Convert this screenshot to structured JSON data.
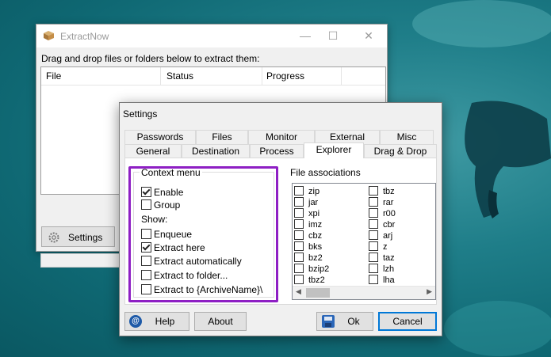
{
  "main_window": {
    "title": "ExtractNow",
    "controls": {
      "minimize": "—",
      "maximize": "☐",
      "close": "✕"
    },
    "hint": "Drag and drop files or folders below to extract them:",
    "columns": [
      "File",
      "Status",
      "Progress"
    ],
    "settings_button": "Settings"
  },
  "settings_dialog": {
    "title": "Settings",
    "tabs_row1": [
      "Passwords",
      "Files",
      "Monitor",
      "External",
      "Misc"
    ],
    "tabs_row2": [
      "General",
      "Destination",
      "Process",
      "Explorer",
      "Drag & Drop"
    ],
    "active_tab": "Explorer",
    "context_menu": {
      "caption": "Context menu",
      "enable": {
        "label": "Enable",
        "checked": true
      },
      "group": {
        "label": "Group",
        "checked": false
      },
      "show_label": "Show:",
      "options": [
        {
          "label": "Enqueue",
          "checked": false
        },
        {
          "label": "Extract here",
          "checked": true
        },
        {
          "label": "Extract automatically",
          "checked": false
        },
        {
          "label": "Extract to folder...",
          "checked": false
        },
        {
          "label": "Extract to {ArchiveName}\\",
          "checked": false
        }
      ]
    },
    "file_associations": {
      "caption": "File associations",
      "col1": [
        "zip",
        "jar",
        "xpi",
        "imz",
        "cbz",
        "bks",
        "bz2",
        "bzip2",
        "tbz2"
      ],
      "col2": [
        "tbz",
        "rar",
        "r00",
        "cbr",
        "arj",
        "z",
        "taz",
        "lzh",
        "lha"
      ]
    },
    "buttons": {
      "help": "Help",
      "about": "About",
      "ok": "Ok",
      "cancel": "Cancel"
    },
    "highlight_color": "#8e1fc4"
  }
}
